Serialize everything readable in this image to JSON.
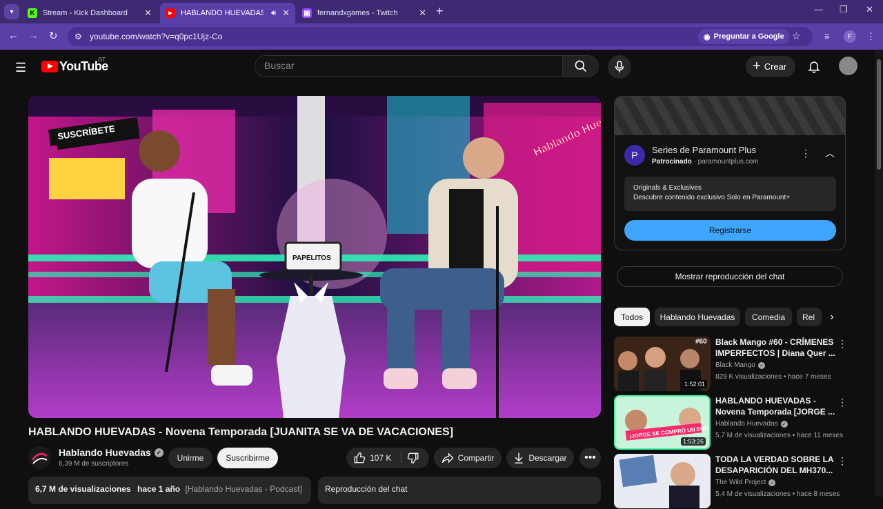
{
  "browser": {
    "tabs": [
      {
        "title": "Stream - Kick Dashboard"
      },
      {
        "title": "HABLANDO HUEVADAS - N"
      },
      {
        "title": "fernandxgames - Twitch"
      }
    ],
    "url": "youtube.com/watch?v=q0pc1Ujz-Co",
    "google_button": "Preguntar a Google",
    "profile_letter": "F"
  },
  "youtube": {
    "logo_text": "YouTube",
    "region": "GT",
    "search_placeholder": "Buscar",
    "create_label": "Crear"
  },
  "video": {
    "title": "HABLANDO HUEVADAS - Novena Temporada [JUANITA SE VA DE VACACIONES]",
    "overlay_subscribe": "SUSCRÍBETE",
    "overlay_brand": "Hablando Huevadas",
    "overlay_sign": "PAPELITOS"
  },
  "channel": {
    "name": "Hablando Huevadas",
    "subscribers": "6,39 M de suscriptores",
    "join_label": "Unirme",
    "subscribe_label": "Suscribirme"
  },
  "actions": {
    "likes": "107 K",
    "share": "Compartir",
    "download": "Descargar"
  },
  "description": {
    "views": "6,7 M de visualizaciones",
    "age": "hace 1 año",
    "tag": "[Hablando Huevadas - Podcast]"
  },
  "chat_replay_label": "Reproducción del chat",
  "ad": {
    "title": "Series de Paramount Plus",
    "sponsored": "Patrocinado",
    "domain": "paramountplus.com",
    "logo_letter": "P",
    "box_line1": "Originals & Exclusives",
    "box_line2": "Descubre contenido exclusivo Solo en Paramount+",
    "cta": "Registrarse"
  },
  "show_chat_label": "Mostrar reproducción del chat",
  "chips": [
    "Todos",
    "Hablando Huevadas",
    "Comedia",
    "Rel"
  ],
  "recommendations": [
    {
      "title": "Black Mango #60 - CRÍMENES IMPERFECTOS | Diana Quer ...",
      "channel": "Black Mango",
      "views": "829 K visualizaciones",
      "age": "hace 7 meses",
      "duration": "1:52:01",
      "thumb_tag": "#60"
    },
    {
      "title": "HABLANDO HUEVADAS - Novena Temporada [JORGE ...",
      "channel": "Hablando Huevadas",
      "views": "5,7 M de visualizaciones",
      "age": "hace 11 meses",
      "duration": "1:53:26",
      "thumb_tag": "¡JORGE SE COMPRÓ UN EQUIPO DE FÚTBOL!"
    },
    {
      "title": "TODA LA VERDAD SOBRE LA DESAPARICIÓN DEL MH370...",
      "channel": "The Wild Project",
      "views": "5,4 M de visualizaciones",
      "age": "hace 8 meses",
      "duration": "",
      "thumb_tag": ""
    }
  ]
}
